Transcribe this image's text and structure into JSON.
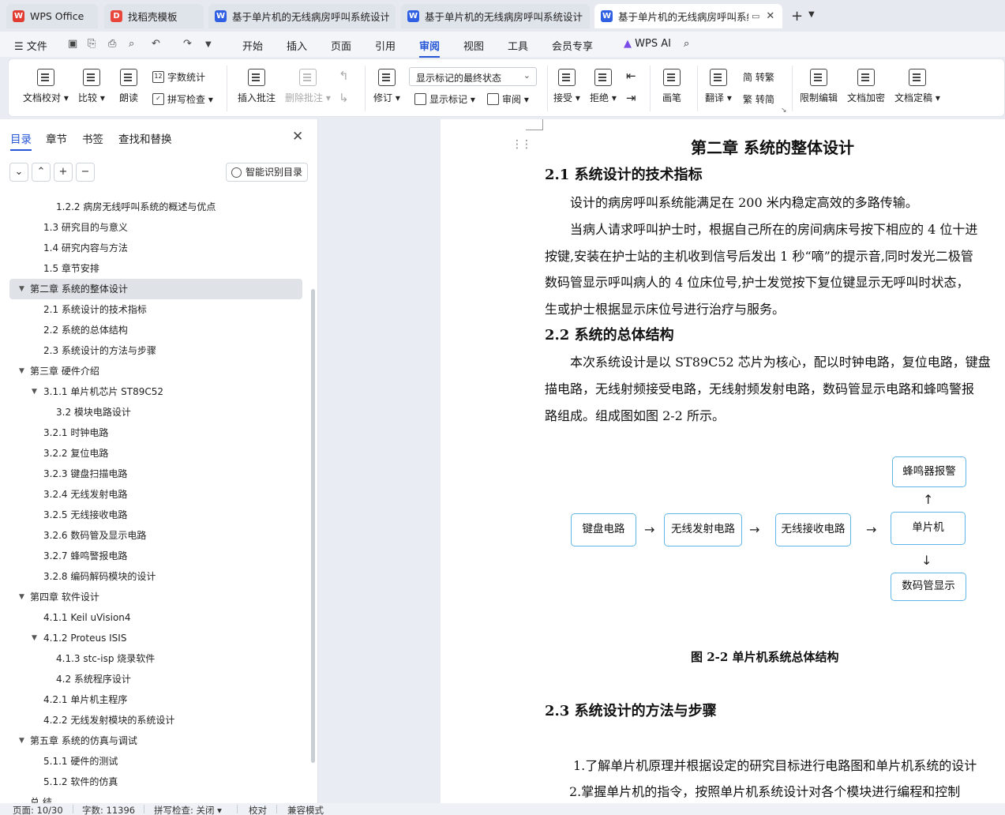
{
  "tabs": [
    {
      "label": "WPS Office",
      "icon": "wps-logo-icon",
      "badge": "W"
    },
    {
      "label": "找稻壳模板",
      "icon": "daoke-icon",
      "badge": "D"
    },
    {
      "label": "基于单片机的无线病房呼叫系统设计",
      "icon": "word-doc-icon",
      "badge": "W"
    },
    {
      "label": "基于单片机的无线病房呼叫系统设计",
      "icon": "word-doc-icon",
      "badge": "W"
    },
    {
      "label": "基于单片机的无线病房呼叫系统",
      "icon": "word-doc-icon",
      "badge": "W"
    }
  ],
  "menu": {
    "file": "文件",
    "items": [
      "开始",
      "插入",
      "页面",
      "引用",
      "审阅",
      "视图",
      "工具",
      "会员专享"
    ],
    "active": "审阅",
    "ai": "WPS AI"
  },
  "ribbon": {
    "doc_check": "文档校对",
    "compare": "比较",
    "read_aloud": "朗读",
    "word_count": "字数统计",
    "spell_check": "拼写检查",
    "insert_comment": "插入批注",
    "delete_comment": "删除批注",
    "track_changes": "修订",
    "markup_mode": "显示标记的最终状态",
    "show_markup": "显示标记",
    "review": "审阅",
    "accept": "接受",
    "reject": "拒绝",
    "pen": "画笔",
    "translate": "翻译",
    "to_traditional": "简 转繁",
    "to_simplified": "繁 转简",
    "restrict_edit": "限制编辑",
    "encrypt": "文档加密",
    "finalize": "文档定稿"
  },
  "nav": {
    "tabs": [
      "目录",
      "章节",
      "书签",
      "查找和替换"
    ],
    "active_tab": "目录",
    "smart_toc": "智能识别目录",
    "toc": [
      {
        "text": "1.2.2 病房无线呼叫系统的概述与优点",
        "level": 3,
        "toggle": ""
      },
      {
        "text": "1.3  研究目的与意义",
        "level": 2,
        "toggle": ""
      },
      {
        "text": "1.4  研究内容与方法",
        "level": 2,
        "toggle": ""
      },
      {
        "text": "1.5  章节安排",
        "level": 2,
        "toggle": ""
      },
      {
        "text": "第二章  系统的整体设计",
        "level": 1,
        "toggle": "▼",
        "active": true
      },
      {
        "text": "2.1 系统设计的技术指标",
        "level": 2,
        "toggle": ""
      },
      {
        "text": "2.2 系统的总体结构",
        "level": 2,
        "toggle": ""
      },
      {
        "text": "2.3 系统设计的方法与步骤",
        "level": 2,
        "toggle": ""
      },
      {
        "text": "第三章  硬件介绍",
        "level": 1,
        "toggle": "▼"
      },
      {
        "text": "3.1.1 单片机芯片 ST89C52",
        "level": 2,
        "toggle": "▼"
      },
      {
        "text": "3.2 模块电路设计",
        "level": 3,
        "toggle": ""
      },
      {
        "text": "3.2.1  时钟电路",
        "level": 2,
        "toggle": ""
      },
      {
        "text": "3.2.2  复位电路",
        "level": 2,
        "toggle": ""
      },
      {
        "text": "3.2.3  键盘扫描电路",
        "level": 2,
        "toggle": ""
      },
      {
        "text": "3.2.4  无线发射电路",
        "level": 2,
        "toggle": ""
      },
      {
        "text": "3.2.5 无线接收电路",
        "level": 2,
        "toggle": ""
      },
      {
        "text": "3.2.6 数码管及显示电路",
        "level": 2,
        "toggle": ""
      },
      {
        "text": "3.2.7 蜂鸣警报电路",
        "level": 2,
        "toggle": ""
      },
      {
        "text": "3.2.8  编码解码模块的设计",
        "level": 2,
        "toggle": ""
      },
      {
        "text": "第四章   软件设计",
        "level": 1,
        "toggle": "▼"
      },
      {
        "text": "4.1.1 Keil uVision4",
        "level": 2,
        "toggle": ""
      },
      {
        "text": "4.1.2 Proteus ISIS",
        "level": 2,
        "toggle": "▼"
      },
      {
        "text": "4.1.3 stc-isp 烧录软件",
        "level": 3,
        "toggle": ""
      },
      {
        "text": "4.2  系统程序设计",
        "level": 3,
        "toggle": ""
      },
      {
        "text": "4.2.1 单片机主程序",
        "level": 2,
        "toggle": ""
      },
      {
        "text": "4.2.2 无线发射模块的系统设计",
        "level": 2,
        "toggle": ""
      },
      {
        "text": "第五章  系统的仿真与调试",
        "level": 1,
        "toggle": "▼"
      },
      {
        "text": "5.1.1  硬件的测试",
        "level": 2,
        "toggle": ""
      },
      {
        "text": "5.1.2  软件的仿真",
        "level": 2,
        "toggle": ""
      },
      {
        "text": "总    结",
        "level": 1,
        "toggle": ""
      }
    ]
  },
  "doc": {
    "chapter_title": "第二章    系统的整体设计",
    "s21_title": "2.1 系统设计的技术指标",
    "s21_p1": "设计的病房呼叫系统能满足在 200 米内稳定高效的多路传输。",
    "s21_p2_l1": "当病人请求呼叫护士时，根据自己所在的房间病床号按下相应的 4 位十进",
    "s21_p2_l2": "按键,安装在护士站的主机收到信号后发出 1 秒“嘀”的提示音,同时发光二极管",
    "s21_p2_l3": "数码管显示呼叫病人的 4 位床位号,护士发觉按下复位键显示无呼叫时状态，",
    "s21_p2_l4": "生或护士根据显示床位号进行治疗与服务。",
    "s22_title": "2.2 系统的总体结构",
    "s22_p1_l1": "本次系统设计是以 ST89C52 芯片为核心，配以时钟电路，复位电路，键盘",
    "s22_p1_l2": "描电路，无线射频接受电路，无线射频发射电路，数码管显示电路和蜂鸣警报",
    "s22_p1_l3": "路组成。组成图如图 2-2 所示。",
    "diagram": {
      "keyboard": "键盘电路",
      "transmit": "无线发射电路",
      "receive": "无线接收电路",
      "mcu": "单片机",
      "buzzer": "蜂鸣器报警",
      "display": "数码管显示",
      "arrow_right": "→",
      "arrow_up": "↑",
      "arrow_down": "↓"
    },
    "figure_caption": "图 2-2  单片机系统总体结构",
    "s23_title": "2.3 系统设计的方法与步骤",
    "s23_item1": "1.了解单片机原理并根据设定的研究目标进行电路图和单片机系统的设计",
    "s23_item2": "2.掌握单片机的指令，按照单片机系统设计对各个模块进行编程和控制"
  },
  "status": {
    "page": "页面: 10/30",
    "words": "字数: 11396",
    "spell": "拼写检查: 关闭",
    "proof": "校对",
    "compat": "兼容模式"
  },
  "colors": {
    "accent": "#2456d6",
    "diagram_border": "#5fb6e6"
  }
}
